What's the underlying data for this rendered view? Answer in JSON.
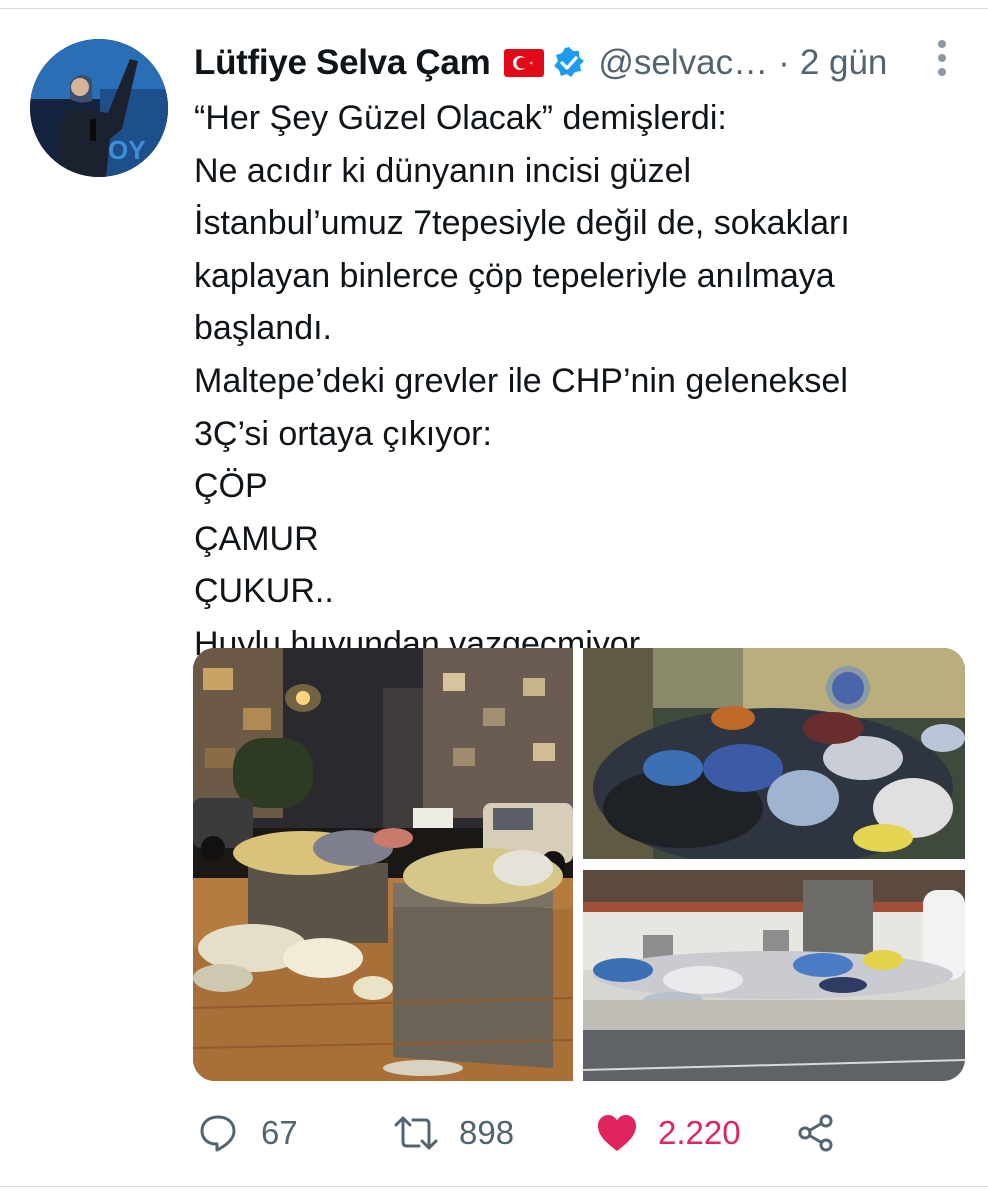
{
  "tweet": {
    "author_name": "Lütfiye Selva Çam",
    "handle": "@selvac…",
    "separator": "·",
    "time": "2 gün",
    "lines": [
      "“Her Şey Güzel Olacak” demişlerdi:",
      "Ne acıdır ki dünyanın incisi güzel",
      "İstanbul’umuz 7tepesiyle değil de, sokakları",
      "kaplayan binlerce çöp tepeleriyle anılmaya",
      "başlandı.",
      "Maltepe’deki grevler ile CHP’nin geleneksel",
      "3Ç’si ortaya çıkıyor:",
      "ÇÖP",
      "ÇAMUR",
      "ÇUKUR..",
      "Huylu huyundan vazgeçmiyor.."
    ]
  },
  "icons": {
    "flag": "turkey-flag-icon",
    "verified": "verified-badge-icon",
    "more": "more-vertical-icon",
    "reply": "reply-icon",
    "retweet": "retweet-icon",
    "like": "heart-filled-icon",
    "share": "share-icon"
  },
  "stats": {
    "replies": "67",
    "retweets": "898",
    "likes": "2.220"
  },
  "colors": {
    "text": "#0f1419",
    "secondary": "#536471",
    "like": "#e0245e",
    "verified": "#1d9bf0",
    "flag": "#e30a17"
  }
}
